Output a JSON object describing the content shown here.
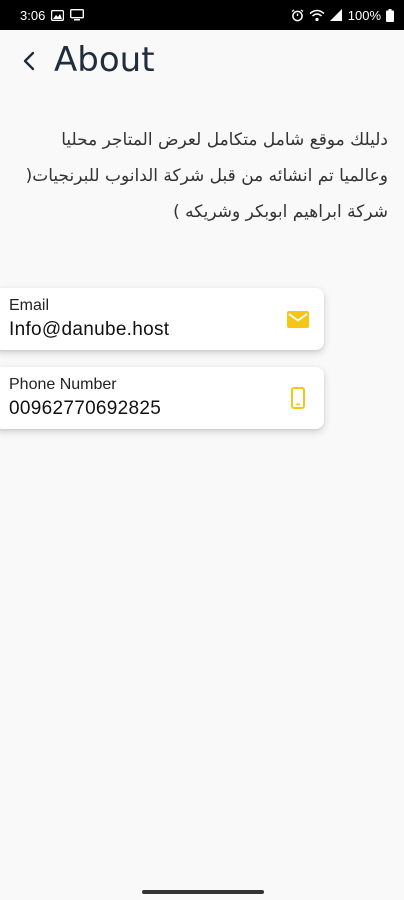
{
  "status_bar": {
    "time": "3:06",
    "battery": "100%"
  },
  "header": {
    "title": "About"
  },
  "about": {
    "description": "دليلك موقع شامل متكامل لعرض المتاجر محليا وعالميا تم انشائه من قبل شركة الدانوب للبرنجيات( شركة ابراهيم ابوبكر وشريكه )"
  },
  "contacts": {
    "email": {
      "label": "Email",
      "value": "Info@danube.host",
      "icon": "mail-icon"
    },
    "phone": {
      "label": "Phone Number",
      "value": "00962770692825",
      "icon": "smartphone-icon"
    }
  },
  "colors": {
    "accent": "#f5c518",
    "title": "#1f2d3d",
    "background": "#f9f9f9"
  }
}
